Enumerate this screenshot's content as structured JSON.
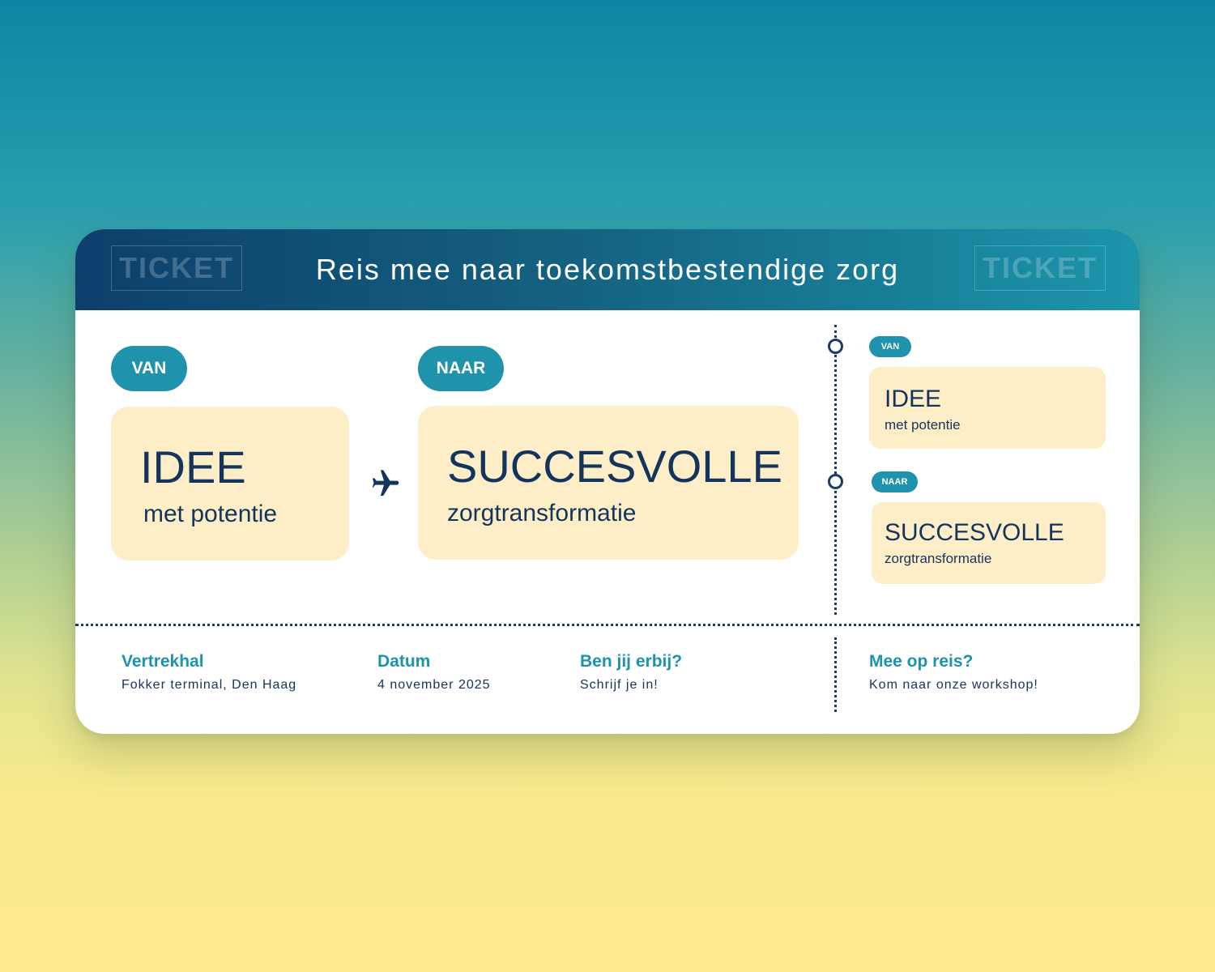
{
  "header": {
    "ticket_left": "TICKET",
    "ticket_right": "TICKET",
    "title": "Reis mee naar toekomstbestendige zorg"
  },
  "main": {
    "from_label": "VAN",
    "to_label": "NAAR",
    "from_title": "IDEE",
    "from_sub": "met potentie",
    "to_title": "SUCCESVOLLE",
    "to_sub": "zorgtransformatie",
    "plane_icon": "airplane-icon"
  },
  "stub": {
    "from_label": "VAN",
    "to_label": "NAAR",
    "from_title": "IDEE",
    "from_sub": "met potentie",
    "to_title": "SUCCESVOLLE",
    "to_sub": "zorgtransformatie"
  },
  "footer": {
    "items": [
      {
        "title": "Vertrekhal",
        "text": "Fokker terminal, Den Haag"
      },
      {
        "title": "Datum",
        "text": "4 november 2025"
      },
      {
        "title": "Ben jij erbij?",
        "text": "Schrijf je in!"
      }
    ],
    "stub": {
      "title": "Mee op reis?",
      "text": "Kom naar onze workshop!"
    }
  },
  "colors": {
    "navy": "#13345c",
    "teal": "#1f92ac",
    "card": "#fdeec8"
  }
}
